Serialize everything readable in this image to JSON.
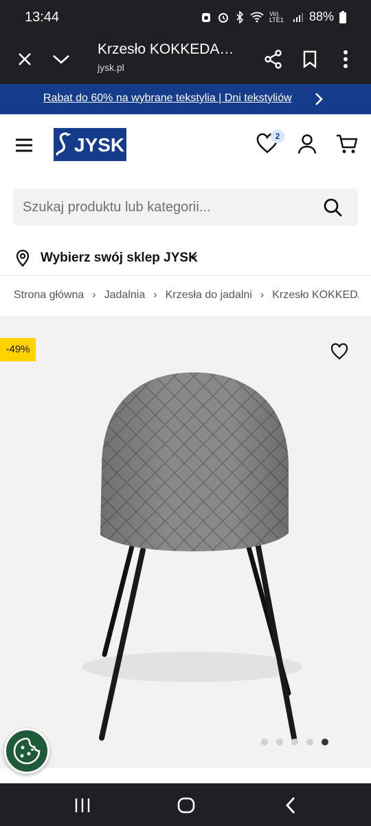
{
  "status_bar": {
    "time": "13:44",
    "signal_label": "Vo) LTE1",
    "battery": "88%"
  },
  "browser": {
    "page_title": "Krzesło KOKKEDA…",
    "domain": "jysk.pl"
  },
  "promo": {
    "text": "Rabat do 60% na wybrane tekstylia | Dni tekstyliów"
  },
  "header": {
    "logo_text": "JYSK",
    "wishlist_count": "2"
  },
  "search": {
    "placeholder": "Szukaj produktu lub kategorii..."
  },
  "store": {
    "label": "Wybierz swój sklep JYSK"
  },
  "breadcrumb": {
    "items": [
      "Strona główna",
      "Jadalnia",
      "Krzesła do jadalni",
      "Krzesło KOKKEDAL"
    ]
  },
  "product": {
    "discount_badge": "-49%",
    "gallery_dots": 5,
    "gallery_active_index": 4
  },
  "colors": {
    "brand_blue": "#143c8a",
    "discount_yellow": "#ffd200",
    "cookie_green": "#1f5a3a"
  }
}
